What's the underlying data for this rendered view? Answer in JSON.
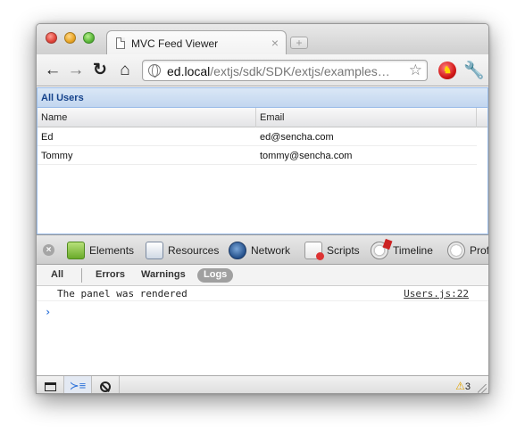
{
  "browser": {
    "tab_title": "MVC Feed Viewer",
    "tab_close_glyph": "×",
    "newtab_glyph": "+",
    "url_host": "ed.local",
    "url_path": "/extjs/sdk/SDK/extjs/examples…",
    "icons": {
      "back": "back-arrow-icon",
      "forward": "forward-arrow-icon",
      "reload": "reload-icon",
      "home": "home-icon",
      "bookmark": "star-icon",
      "extension": "devil-extension-icon",
      "menu": "wrench-icon"
    }
  },
  "panel": {
    "title": "All Users",
    "columns": [
      "Name",
      "Email"
    ],
    "rows": [
      {
        "name": "Ed",
        "email": "ed@sencha.com"
      },
      {
        "name": "Tommy",
        "email": "tommy@sencha.com"
      }
    ]
  },
  "devtools": {
    "tabs": [
      "Elements",
      "Resources",
      "Network",
      "Scripts",
      "Timeline",
      "Profi"
    ],
    "filters": {
      "all": "All",
      "errors": "Errors",
      "warnings": "Warnings",
      "logs": "Logs"
    },
    "active_filter": "Logs",
    "console": {
      "messages": [
        {
          "text": "The panel was rendered",
          "source": "Users.js:22"
        }
      ],
      "prompt": "›"
    },
    "warning_count": "3"
  },
  "colors": {
    "panel_border": "#99bbe8",
    "panel_header_text": "#15428b",
    "console_prompt": "#2d72d9",
    "warning": "#e2a300"
  }
}
